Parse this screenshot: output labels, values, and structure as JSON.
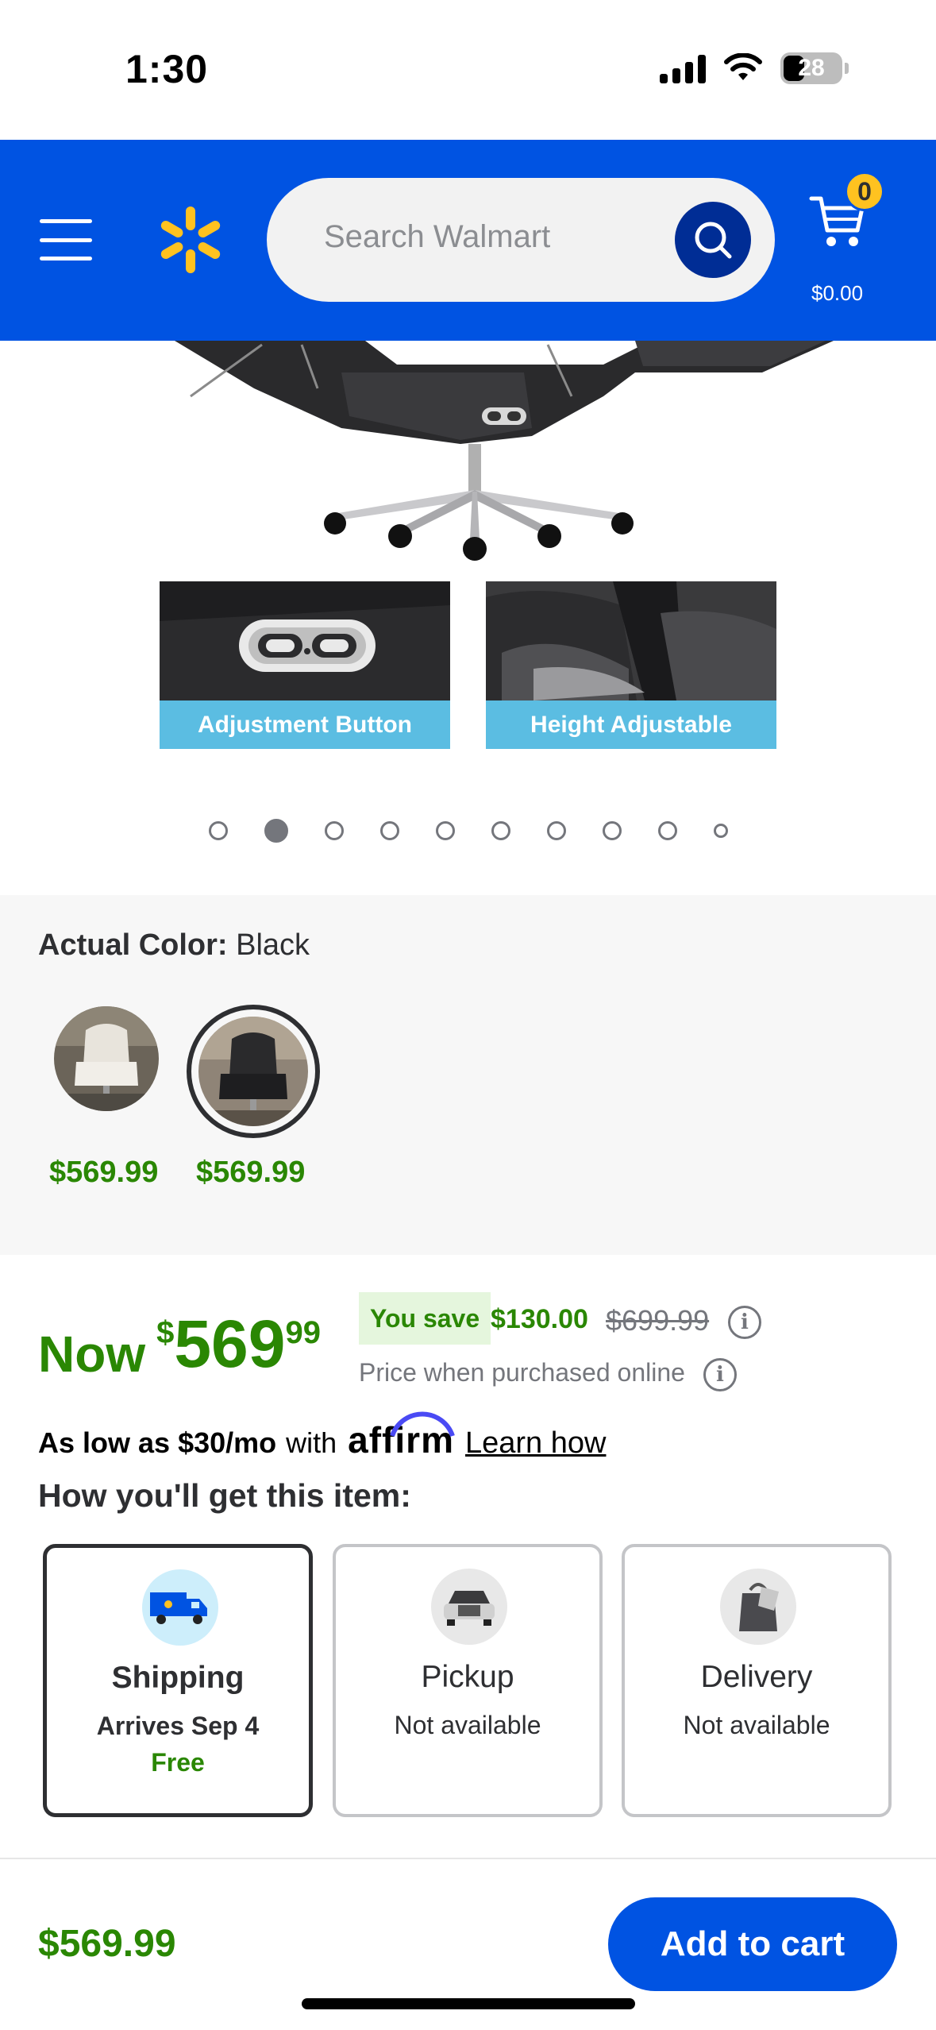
{
  "status_bar": {
    "time": "1:30",
    "battery": "28"
  },
  "header": {
    "search_placeholder": "Search Walmart",
    "cart_count": "0",
    "cart_total": "$0.00"
  },
  "gallery": {
    "thumbnails": [
      {
        "label": "Adjustment Button"
      },
      {
        "label": "Height Adjustable"
      }
    ],
    "dot_count": 10,
    "active_dot": 2
  },
  "color": {
    "label": "Actual Color:",
    "value": "Black",
    "options": [
      {
        "name": "White",
        "price": "$569.99"
      },
      {
        "name": "Black",
        "price": "$569.99",
        "selected": true
      }
    ]
  },
  "price": {
    "now_label": "Now",
    "currency": "$",
    "dollars": "569",
    "cents": "99",
    "you_save_label": "You save",
    "save_amount": "$130.00",
    "was_price": "$699.99",
    "note": "Price when purchased online"
  },
  "affirm": {
    "as_low": "As low as $30/mo",
    "with": "with",
    "brand": "affirm",
    "learn_how": "Learn how"
  },
  "fulfillment": {
    "title": "How you'll get this item:",
    "options": [
      {
        "title": "Shipping",
        "subtitle": "Arrives Sep 4",
        "extra": "Free"
      },
      {
        "title": "Pickup",
        "subtitle": "Not available"
      },
      {
        "title": "Delivery",
        "subtitle": "Not available"
      }
    ]
  },
  "footer": {
    "price": "$569.99",
    "add_to_cart": "Add to cart"
  },
  "colors": {
    "brand_blue": "#0053e2",
    "spark_yellow": "#ffc220",
    "price_green": "#2a8703",
    "thumb_label_blue": "#5bbde2"
  }
}
